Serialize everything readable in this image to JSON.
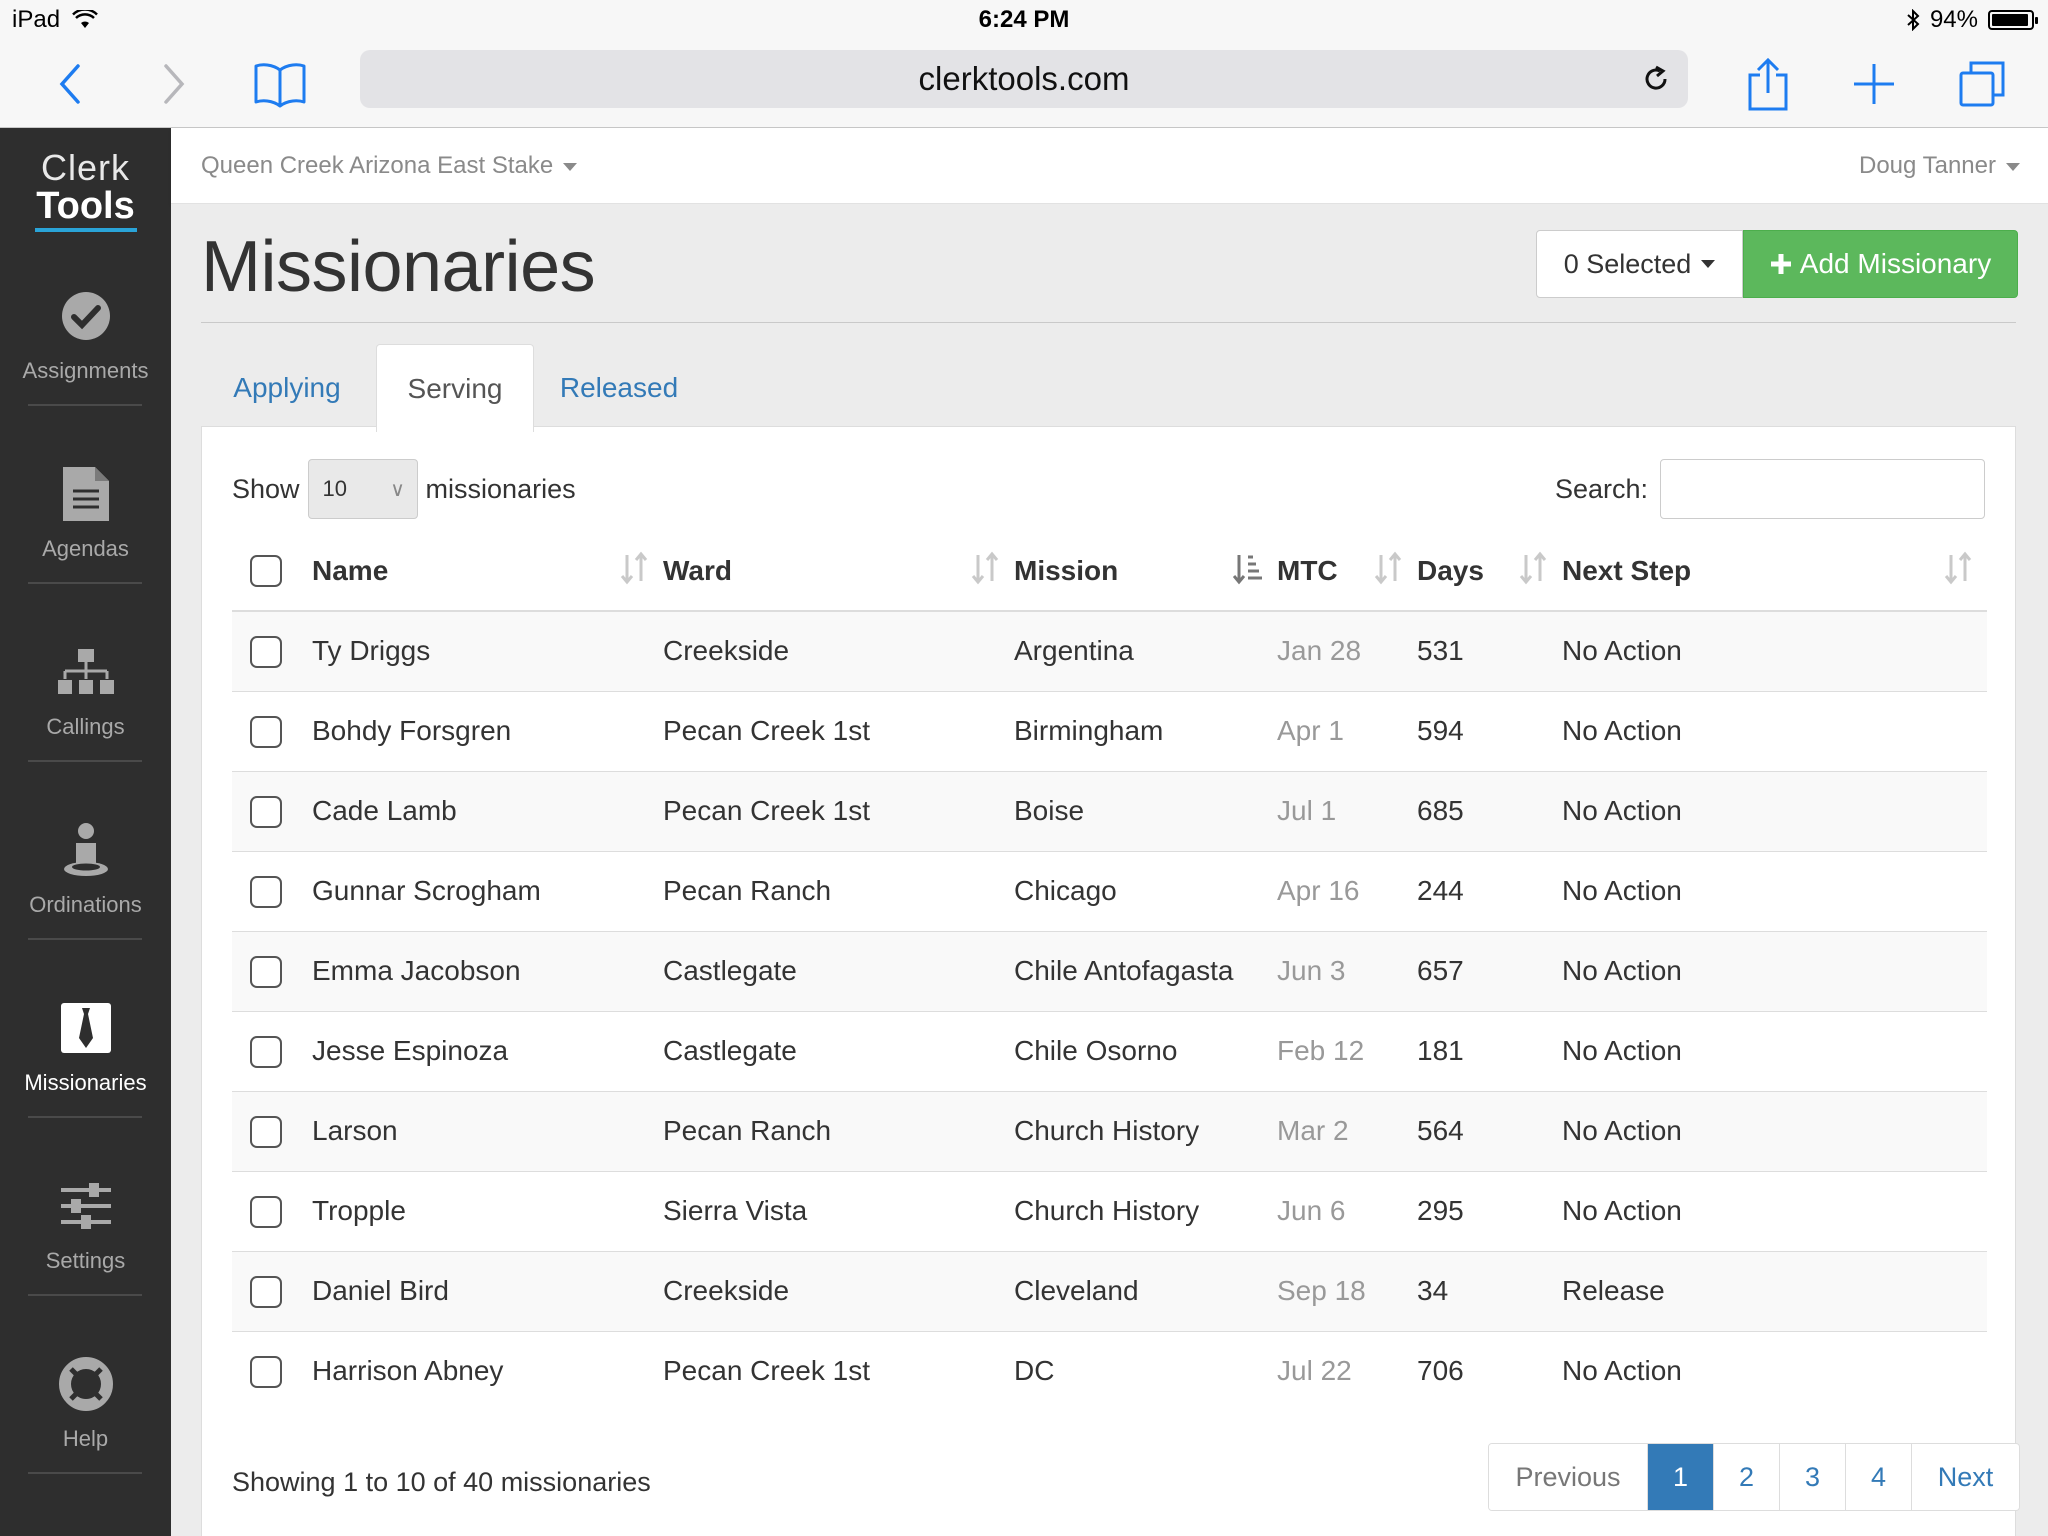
{
  "status_bar": {
    "device": "iPad",
    "time": "6:24 PM",
    "battery": "94%",
    "battery_level": 0.94
  },
  "browser": {
    "url": "clerktools.com"
  },
  "logo": {
    "line1": "Clerk",
    "line2": "Tools"
  },
  "sidebar": {
    "items": [
      {
        "label": "Assignments",
        "icon": "check-circle-icon"
      },
      {
        "label": "Agendas",
        "icon": "document-icon"
      },
      {
        "label": "Callings",
        "icon": "org-chart-icon"
      },
      {
        "label": "Ordinations",
        "icon": "person-icon"
      },
      {
        "label": "Missionaries",
        "icon": "tie-icon",
        "active": true
      },
      {
        "label": "Settings",
        "icon": "sliders-icon"
      },
      {
        "label": "Help",
        "icon": "lifebuoy-icon"
      }
    ]
  },
  "topbar": {
    "stake": "Queen Creek Arizona East Stake",
    "user": "Doug Tanner"
  },
  "page": {
    "title": "Missionaries",
    "selected_button": "0 Selected",
    "add_button": "Add Missionary"
  },
  "tabs": [
    {
      "label": "Applying",
      "active": false
    },
    {
      "label": "Serving",
      "active": true
    },
    {
      "label": "Released",
      "active": false
    }
  ],
  "table_controls": {
    "show_label": "Show",
    "show_value": "10",
    "show_suffix": "missionaries",
    "search_label": "Search:",
    "search_value": "",
    "search_placeholder": ""
  },
  "table": {
    "columns": [
      "Name",
      "Ward",
      "Mission",
      "MTC",
      "Days",
      "Next Step"
    ],
    "sorted_column": "Mission",
    "rows": [
      {
        "name": "Ty Driggs",
        "ward": "Creekside",
        "mission": "Argentina",
        "mtc": "Jan 28",
        "days": "531",
        "next_step": "No Action"
      },
      {
        "name": "Bohdy Forsgren",
        "ward": "Pecan Creek 1st",
        "mission": "Birmingham",
        "mtc": "Apr 1",
        "days": "594",
        "next_step": "No Action"
      },
      {
        "name": "Cade Lamb",
        "ward": "Pecan Creek 1st",
        "mission": "Boise",
        "mtc": "Jul 1",
        "days": "685",
        "next_step": "No Action"
      },
      {
        "name": "Gunnar Scrogham",
        "ward": "Pecan Ranch",
        "mission": "Chicago",
        "mtc": "Apr 16",
        "days": "244",
        "next_step": "No Action"
      },
      {
        "name": "Emma Jacobson",
        "ward": "Castlegate",
        "mission": "Chile Antofagasta",
        "mtc": "Jun 3",
        "days": "657",
        "next_step": "No Action"
      },
      {
        "name": "Jesse Espinoza",
        "ward": "Castlegate",
        "mission": "Chile Osorno",
        "mtc": "Feb 12",
        "days": "181",
        "next_step": "No Action"
      },
      {
        "name": "Larson",
        "ward": "Pecan Ranch",
        "mission": "Church History",
        "mtc": "Mar 2",
        "days": "564",
        "next_step": "No Action"
      },
      {
        "name": "Tropple",
        "ward": "Sierra Vista",
        "mission": "Church History",
        "mtc": "Jun 6",
        "days": "295",
        "next_step": "No Action"
      },
      {
        "name": "Daniel Bird",
        "ward": "Creekside",
        "mission": "Cleveland",
        "mtc": "Sep 18",
        "days": "34",
        "next_step": "Release"
      },
      {
        "name": "Harrison Abney",
        "ward": "Pecan Creek 1st",
        "mission": "DC",
        "mtc": "Jul 22",
        "days": "706",
        "next_step": "No Action"
      }
    ]
  },
  "footer": {
    "info": "Showing 1 to 10 of 40 missionaries",
    "pagination": {
      "previous": "Previous",
      "pages": [
        "1",
        "2",
        "3",
        "4"
      ],
      "current": "1",
      "next": "Next"
    }
  },
  "colors": {
    "sidebar_bg": "#2e2e2e",
    "accent_link": "#337ab7",
    "add_button": "#5cb85c",
    "safari_blue": "#1e7cf0",
    "logo_underline": "#2aa4d8"
  }
}
